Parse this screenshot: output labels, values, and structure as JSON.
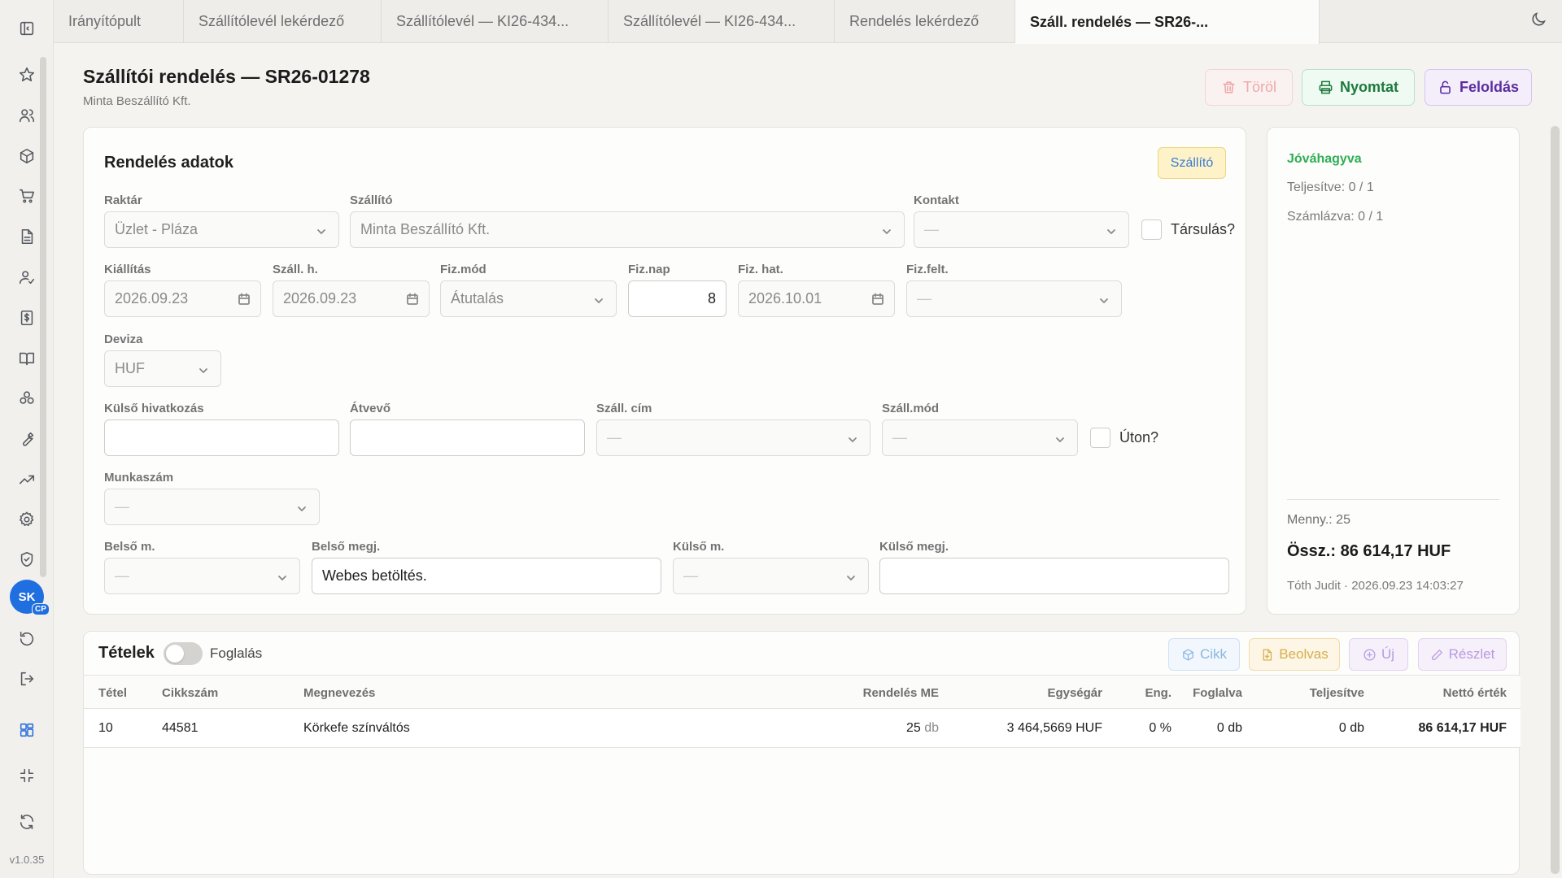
{
  "app": {
    "version": "v1.0.35"
  },
  "tabs": [
    {
      "label": "Irányítópult"
    },
    {
      "label": "Szállítólevél lekérdező"
    },
    {
      "label": "Szállítólevél — KI26-434..."
    },
    {
      "label": "Szállítólevél — KI26-434..."
    },
    {
      "label": "Rendelés lekérdező"
    },
    {
      "label": "Száll. rendelés — SR26-..."
    }
  ],
  "user": {
    "initials": "SK",
    "badge": "CP"
  },
  "sidebar_icons": [
    "sidebar-toggle-icon",
    "star-icon",
    "users-icon",
    "box-icon",
    "cart-icon",
    "document-icon",
    "user-check-icon",
    "invoice-icon",
    "book-icon",
    "boxes-icon",
    "wrench-icon",
    "trending-icon",
    "gear-icon",
    "shield-icon",
    "undo-icon",
    "logout-icon",
    "grid-icon",
    "collapse-icon",
    "refresh-icon"
  ],
  "header": {
    "title": "Szállítói rendelés — SR26-01278",
    "subtitle": "Minta Beszállító Kft.",
    "delete_label": "Töröl",
    "print_label": "Nyomtat",
    "unlock_label": "Feloldás"
  },
  "order": {
    "title": "Rendelés adatok",
    "badge": "Szállító",
    "warehouse": {
      "label": "Raktár",
      "value": "Üzlet - Pláza"
    },
    "supplier": {
      "label": "Szállító",
      "value": "Minta Beszállító Kft."
    },
    "contact": {
      "label": "Kontakt",
      "value": "—"
    },
    "association": {
      "label": "Társulás?"
    },
    "issue_date": {
      "label": "Kiállítás",
      "value": "2026.09.23"
    },
    "delivery_date": {
      "label": "Száll. h.",
      "value": "2026.09.23"
    },
    "payment_method": {
      "label": "Fiz.mód",
      "value": "Átutalás"
    },
    "payment_days": {
      "label": "Fiz.nap",
      "value": "8"
    },
    "payment_due": {
      "label": "Fiz. hat.",
      "value": "2026.10.01"
    },
    "payment_terms": {
      "label": "Fiz.felt.",
      "value": "—"
    },
    "currency": {
      "label": "Deviza",
      "value": "HUF"
    },
    "external_ref": {
      "label": "Külső hivatkozás",
      "value": ""
    },
    "receiver": {
      "label": "Átvevő",
      "value": ""
    },
    "delivery_address": {
      "label": "Száll. cím",
      "value": "—"
    },
    "delivery_mode": {
      "label": "Száll.mód",
      "value": "—"
    },
    "in_transit": {
      "label": "Úton?"
    },
    "job_number": {
      "label": "Munkaszám",
      "value": "—"
    },
    "internal_note_type": {
      "label": "Belső m.",
      "value": "—"
    },
    "internal_note": {
      "label": "Belső megj.",
      "value": "Webes betöltés."
    },
    "external_note_type": {
      "label": "Külső m.",
      "value": "—"
    },
    "external_note": {
      "label": "Külső megj.",
      "value": ""
    }
  },
  "status": {
    "state": "Jóváhagyva",
    "fulfilled": "Teljesítve: 0 / 1",
    "invoiced": "Számlázva: 0 / 1",
    "quantity": "Menny.: 25",
    "total": "Össz.: 86 614,17 HUF",
    "audit": "Tóth Judit · 2026.09.23 14:03:27",
    "colors": {
      "approved": "#2fae54"
    }
  },
  "items": {
    "title": "Tételek",
    "reserve_label": "Foglalás",
    "reserve_on": false,
    "buttons": {
      "item": "Cikk",
      "read": "Beolvas",
      "new": "Új",
      "detail": "Részlet"
    },
    "columns": [
      "Tétel",
      "Cikkszám",
      "Megnevezés",
      "Rendelés ME",
      "Egységár",
      "Eng.",
      "Foglalva",
      "Teljesítve",
      "Nettó érték"
    ],
    "rows": [
      {
        "line": "10",
        "sku": "44581",
        "name": "Körkefe színváltós",
        "qty": "25",
        "unit": "db",
        "price": "3 464,5669 HUF",
        "discount": "0 %",
        "reserved": "0 db",
        "fulfilled": "0 db",
        "net": "86 614,17 HUF"
      }
    ]
  }
}
